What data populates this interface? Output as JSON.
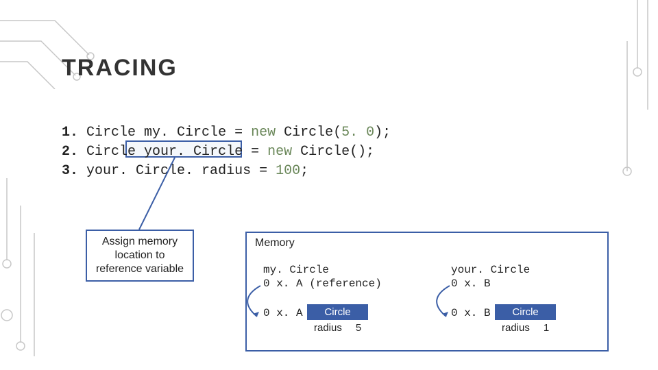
{
  "heading": "TRACING",
  "code": {
    "l1": {
      "n": "1.",
      "a": "Circle my. Circle = ",
      "kw": "new",
      "b": " Circle(",
      "lit": "5. 0",
      "c": ");"
    },
    "l2": {
      "n": "2.",
      "a": "Circle your. Circle = ",
      "kw": "new",
      "b": " Circle();"
    },
    "l3": {
      "n": "3.",
      "a": "your. Circle. radius = ",
      "lit": "100",
      "c": ";"
    }
  },
  "annotation": "Assign memory location to reference variable",
  "memory": {
    "title": "Memory",
    "my": {
      "name": "my. Circle",
      "ref": "0 x. A (reference)"
    },
    "your": {
      "name": "your. Circle",
      "ref": "0 x. B"
    },
    "addrA": "0 x. A",
    "addrB": "0 x. B",
    "objA": {
      "type": "Circle",
      "field": "radius",
      "value": "5"
    },
    "objB": {
      "type": "Circle",
      "field": "radius",
      "value": "1"
    }
  }
}
